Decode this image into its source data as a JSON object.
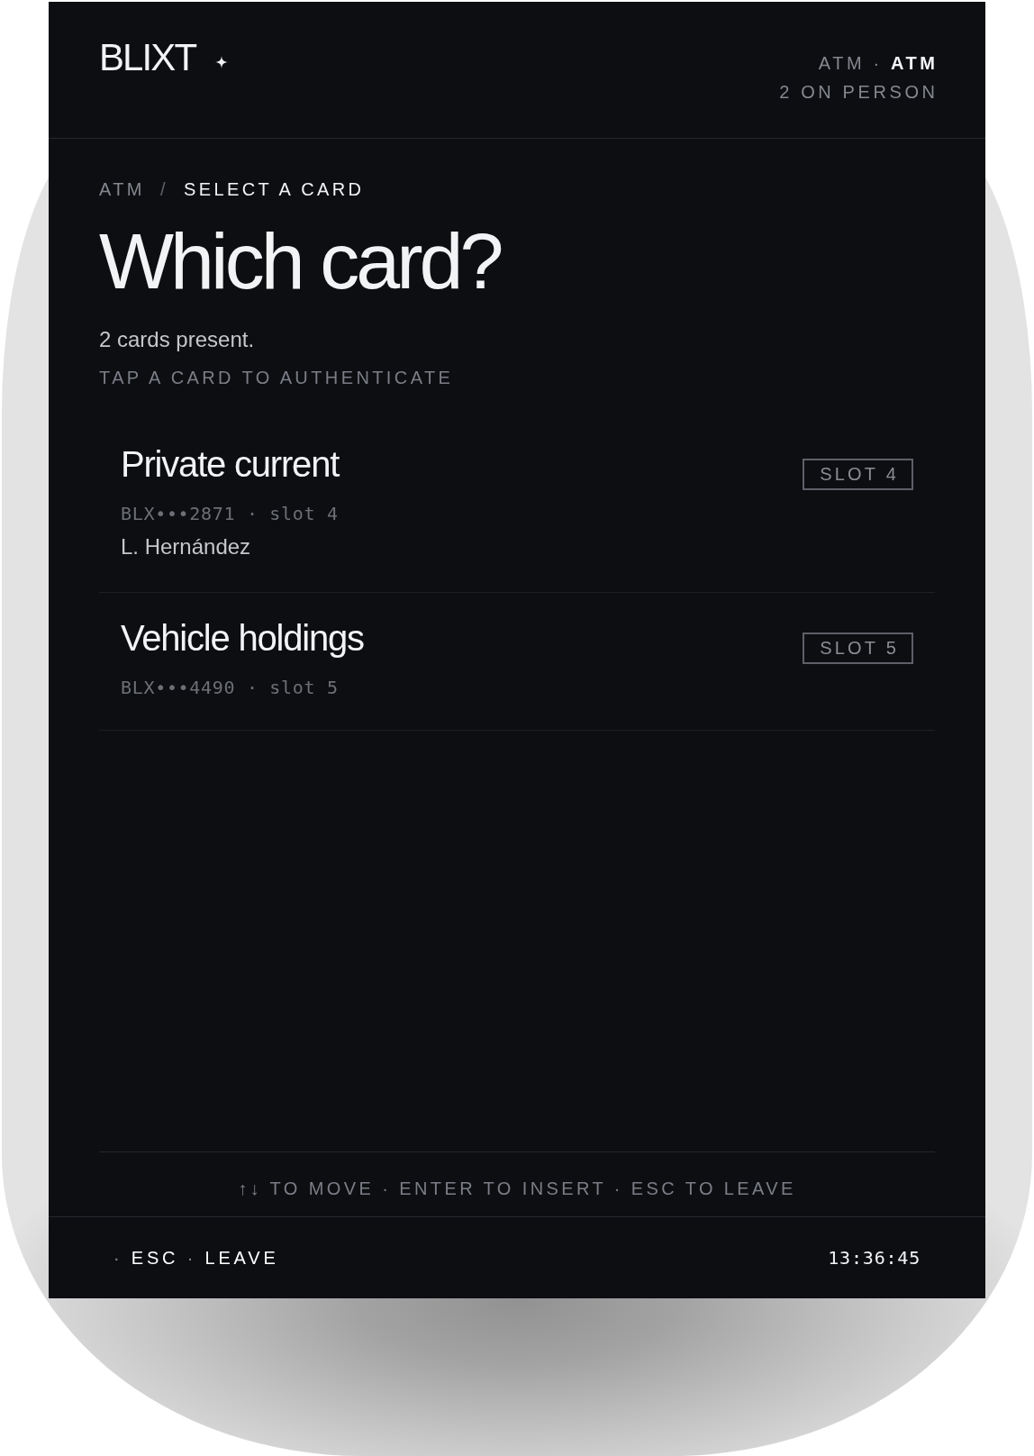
{
  "header": {
    "logo": "BLIXT",
    "status": "ATM · **ATM**",
    "presence": "2 ON PERSON"
  },
  "breadcrumb": {
    "separator": "/",
    "items": [
      {
        "label": "ATM",
        "current": false
      },
      {
        "label": "SELECT A CARD",
        "current": true
      }
    ]
  },
  "title": "Which card?",
  "summary": "2 cards present.",
  "instruction": "TAP A CARD TO AUTHENTICATE",
  "cards": [
    {
      "name": "Private current",
      "number": "BLX•••2871 · slot 4",
      "holder": "L. Hernández",
      "slot": "SLOT 4"
    },
    {
      "name": "Vehicle holdings",
      "number": "BLX•••4490 · slot 5",
      "slot": "SLOT 5"
    }
  ],
  "key_hint": "↑↓ TO MOVE · ENTER TO INSERT · ESC TO LEAVE",
  "footer": {
    "keys": "· **ESC** · **LEAVE**",
    "clock": "13:36:45"
  }
}
